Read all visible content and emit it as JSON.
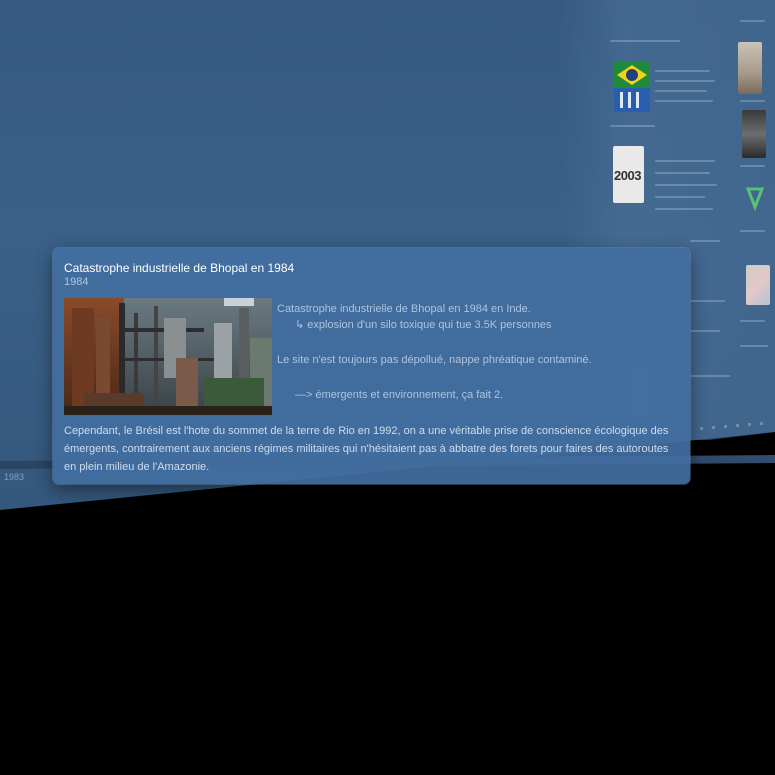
{
  "wall": {
    "left_year": "1983",
    "thumbnail_year": "2003"
  },
  "card": {
    "title": "Catastrophe industrielle de Bhopal en 1984",
    "year": "1984",
    "photo_alt": "Usine de Bhopal",
    "body": {
      "line1": "Catastrophe industrielle de Bhopal en 1984 en Inde.",
      "line2_arrow": "↳",
      "line2": "explosion d'un silo toxique qui tue 3.5K personnes",
      "line3": "Le site n'est toujours pas dépollué, nappe phréatique contaminé.",
      "line4": "—> émergents et environnement, ça fait 2."
    },
    "footer": "Cependant, le Brésil est l'hote du sommet de la terre de Rio en 1992, on a une véritable prise de conscience écologique des émergents, contrairement aux anciens régimes militaires qui n'hésitaient pas à abbatre des forets pour faires des autoroutes en plein milieu de l'Amazonie."
  },
  "colors": {
    "wall": "#365a82",
    "card": "#426ea0",
    "background": "#000000"
  }
}
